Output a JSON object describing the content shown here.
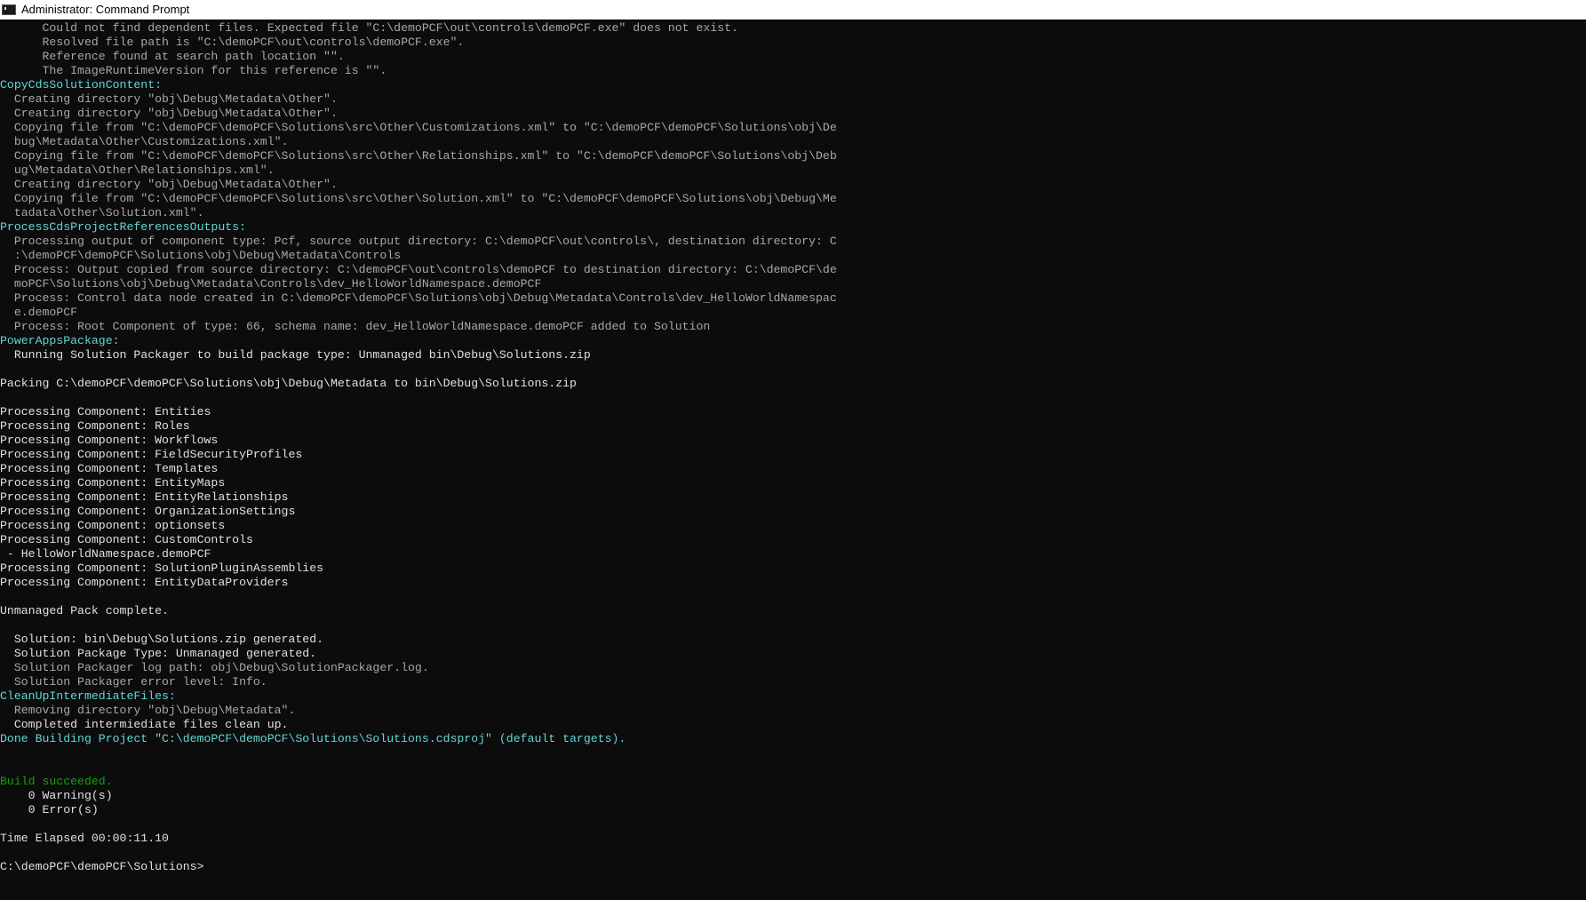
{
  "window": {
    "title": "Administrator: Command Prompt"
  },
  "console": {
    "lines": [
      {
        "text": "      Could not find dependent files. Expected file \"C:\\demoPCF\\out\\controls\\demoPCF.exe\" does not exist.",
        "style": "dim"
      },
      {
        "text": "      Resolved file path is \"C:\\demoPCF\\out\\controls\\demoPCF.exe\".",
        "style": "dim"
      },
      {
        "text": "      Reference found at search path location \"\".",
        "style": "dim"
      },
      {
        "text": "      The ImageRuntimeVersion for this reference is \"\".",
        "style": "dim"
      },
      {
        "text": "CopyCdsSolutionContent:",
        "style": "cyan2"
      },
      {
        "text": "  Creating directory \"obj\\Debug\\Metadata\\Other\".",
        "style": "dim"
      },
      {
        "text": "  Creating directory \"obj\\Debug\\Metadata\\Other\".",
        "style": "dim"
      },
      {
        "text": "  Copying file from \"C:\\demoPCF\\demoPCF\\Solutions\\src\\Other\\Customizations.xml\" to \"C:\\demoPCF\\demoPCF\\Solutions\\obj\\De",
        "style": "dim"
      },
      {
        "text": "  bug\\Metadata\\Other\\Customizations.xml\".",
        "style": "dim"
      },
      {
        "text": "  Copying file from \"C:\\demoPCF\\demoPCF\\Solutions\\src\\Other\\Relationships.xml\" to \"C:\\demoPCF\\demoPCF\\Solutions\\obj\\Deb",
        "style": "dim"
      },
      {
        "text": "  ug\\Metadata\\Other\\Relationships.xml\".",
        "style": "dim"
      },
      {
        "text": "  Creating directory \"obj\\Debug\\Metadata\\Other\".",
        "style": "dim"
      },
      {
        "text": "  Copying file from \"C:\\demoPCF\\demoPCF\\Solutions\\src\\Other\\Solution.xml\" to \"C:\\demoPCF\\demoPCF\\Solutions\\obj\\Debug\\Me",
        "style": "dim"
      },
      {
        "text": "  tadata\\Other\\Solution.xml\".",
        "style": "dim"
      },
      {
        "text": "ProcessCdsProjectReferencesOutputs:",
        "style": "cyan2"
      },
      {
        "text": "  Processing output of component type: Pcf, source output directory: C:\\demoPCF\\out\\controls\\, destination directory: C",
        "style": "dim"
      },
      {
        "text": "  :\\demoPCF\\demoPCF\\Solutions\\obj\\Debug\\Metadata\\Controls",
        "style": "dim"
      },
      {
        "text": "  Process: Output copied from source directory: C:\\demoPCF\\out\\controls\\demoPCF to destination directory: C:\\demoPCF\\de",
        "style": "dim"
      },
      {
        "text": "  moPCF\\Solutions\\obj\\Debug\\Metadata\\Controls\\dev_HelloWorldNamespace.demoPCF",
        "style": "dim"
      },
      {
        "text": "  Process: Control data node created in C:\\demoPCF\\demoPCF\\Solutions\\obj\\Debug\\Metadata\\Controls\\dev_HelloWorldNamespac",
        "style": "dim"
      },
      {
        "text": "  e.demoPCF",
        "style": "dim"
      },
      {
        "text": "  Process: Root Component of type: 66, schema name: dev_HelloWorldNamespace.demoPCF added to Solution",
        "style": "dim"
      },
      {
        "text": "PowerAppsPackage:",
        "style": "cyan2"
      },
      {
        "text": "  Running Solution Packager to build package type: Unmanaged bin\\Debug\\Solutions.zip",
        "style": "bright"
      },
      {
        "text": "",
        "style": "norm"
      },
      {
        "text": "Packing C:\\demoPCF\\demoPCF\\Solutions\\obj\\Debug\\Metadata to bin\\Debug\\Solutions.zip",
        "style": "bright"
      },
      {
        "text": "",
        "style": "norm"
      },
      {
        "text": "Processing Component: Entities",
        "style": "bright"
      },
      {
        "text": "Processing Component: Roles",
        "style": "bright"
      },
      {
        "text": "Processing Component: Workflows",
        "style": "bright"
      },
      {
        "text": "Processing Component: FieldSecurityProfiles",
        "style": "bright"
      },
      {
        "text": "Processing Component: Templates",
        "style": "bright"
      },
      {
        "text": "Processing Component: EntityMaps",
        "style": "bright"
      },
      {
        "text": "Processing Component: EntityRelationships",
        "style": "bright"
      },
      {
        "text": "Processing Component: OrganizationSettings",
        "style": "bright"
      },
      {
        "text": "Processing Component: optionsets",
        "style": "bright"
      },
      {
        "text": "Processing Component: CustomControls",
        "style": "bright"
      },
      {
        "text": " - HelloWorldNamespace.demoPCF",
        "style": "bright"
      },
      {
        "text": "Processing Component: SolutionPluginAssemblies",
        "style": "bright"
      },
      {
        "text": "Processing Component: EntityDataProviders",
        "style": "bright"
      },
      {
        "text": "",
        "style": "norm"
      },
      {
        "text": "Unmanaged Pack complete.",
        "style": "bright"
      },
      {
        "text": "",
        "style": "norm"
      },
      {
        "text": "  Solution: bin\\Debug\\Solutions.zip generated.",
        "style": "bright"
      },
      {
        "text": "  Solution Package Type: Unmanaged generated.",
        "style": "bright"
      },
      {
        "text": "  Solution Packager log path: obj\\Debug\\SolutionPackager.log.",
        "style": "dim"
      },
      {
        "text": "  Solution Packager error level: Info.",
        "style": "dim"
      },
      {
        "text": "CleanUpIntermediateFiles:",
        "style": "cyan2"
      },
      {
        "text": "  Removing directory \"obj\\Debug\\Metadata\".",
        "style": "dim"
      },
      {
        "text": "  Completed intermiediate files clean up.",
        "style": "bright"
      },
      {
        "text": "Done Building Project \"C:\\demoPCF\\demoPCF\\Solutions\\Solutions.cdsproj\" (default targets).",
        "style": "cyan2"
      },
      {
        "text": "",
        "style": "norm"
      },
      {
        "text": "",
        "style": "norm"
      },
      {
        "text": "Build succeeded.",
        "style": "green"
      },
      {
        "text": "    0 Warning(s)",
        "style": "bright"
      },
      {
        "text": "    0 Error(s)",
        "style": "bright"
      },
      {
        "text": "",
        "style": "norm"
      },
      {
        "text": "Time Elapsed 00:00:11.10",
        "style": "bright"
      },
      {
        "text": "",
        "style": "norm"
      },
      {
        "text": "C:\\demoPCF\\demoPCF\\Solutions>",
        "style": "bright"
      }
    ]
  },
  "colors": {
    "background": "#0c0c0c",
    "dim": "#a8a8a8",
    "text": "#cccccc",
    "cyan": "#61d6d6",
    "green": "#13a10e"
  },
  "icons": {
    "app": "console-icon"
  }
}
